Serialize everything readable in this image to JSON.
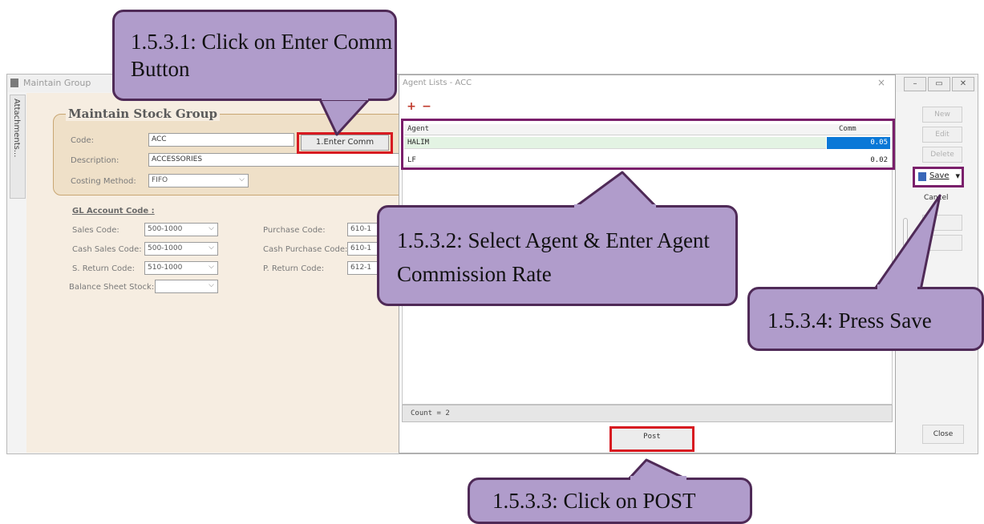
{
  "main_window": {
    "title": "Maintain Group",
    "controls": [
      "–",
      "▭",
      "✕"
    ],
    "attachments_tab": "Attachments...",
    "group_title": "Maintain Stock Group",
    "code_label": "Code:",
    "code_value": "ACC",
    "description_label": "Description:",
    "description_value": "ACCESSORIES",
    "costing_label": "Costing Method:",
    "costing_value": "FIFO",
    "enter_comm_button": "1.Enter Comm",
    "gl_title": "GL Account Code :",
    "sales_code_label": "Sales Code:",
    "sales_code_value": "500-1000",
    "cash_sales_label": "Cash Sales Code:",
    "cash_sales_value": "500-1000",
    "sreturn_label": "S. Return Code:",
    "sreturn_value": "510-1000",
    "balance_label": "Balance Sheet Stock:",
    "balance_value": "",
    "purchase_label": "Purchase Code:",
    "purchase_value": "610-1",
    "cash_purchase_label": "Cash Purchase Code:",
    "cash_purchase_value": "610-1",
    "preturn_label": "P. Return Code:",
    "preturn_value": "612-1"
  },
  "dialog": {
    "title": "Agent Lists - ACC",
    "close": "×",
    "add_icon": "+",
    "remove_icon": "−",
    "columns": [
      "Agent",
      "Comm"
    ],
    "rows": [
      {
        "agent": "HALIM",
        "comm": "0.05"
      },
      {
        "agent": "LF",
        "comm": "0.02"
      }
    ],
    "count_text": "Count = 2",
    "post_button": "Post"
  },
  "toolbar": {
    "new": "New",
    "edit": "Edit",
    "delete": "Delete",
    "save": "Save",
    "save_arrow": "▾",
    "cancel": "Cancel",
    "close": "Close"
  },
  "callouts": {
    "c1": "1.5.3.1: Click on Enter Comm Button",
    "c2": "1.5.3.2: Select Agent & Enter Agent Commission Rate",
    "c3": "1.5.3.3: Click on POST",
    "c4": "1.5.3.4: Press Save"
  },
  "colors": {
    "callout_fill": "#b09ccb",
    "callout_border": "#4f2a57",
    "highlight_red": "#d71920",
    "highlight_purple": "#7a1f6b",
    "selected_cell": "#0a78d7"
  }
}
